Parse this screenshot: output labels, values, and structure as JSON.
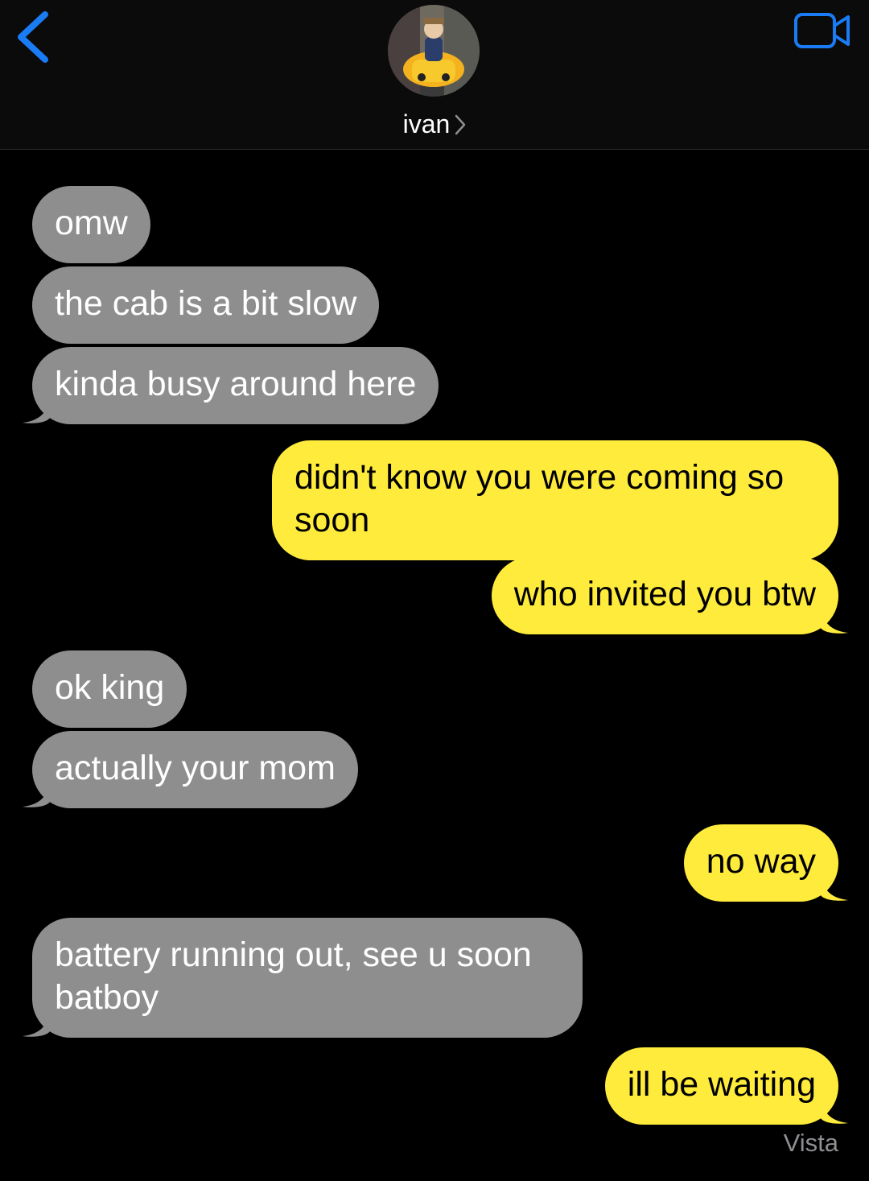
{
  "header": {
    "contact_name": "ivan",
    "back_icon": "chevron-left-icon",
    "video_icon": "video-camera-icon",
    "accent_color": "#1a7cf5"
  },
  "messages": [
    {
      "dir": "in",
      "text": "omw"
    },
    {
      "dir": "in",
      "text": "the cab is a bit slow"
    },
    {
      "dir": "in",
      "text": "kinda busy around here"
    },
    {
      "dir": "out",
      "text": "didn't know you were coming so soon"
    },
    {
      "dir": "out",
      "text": "who invited you btw"
    },
    {
      "dir": "in",
      "text": "ok king"
    },
    {
      "dir": "in",
      "text": "actually your mom"
    },
    {
      "dir": "out",
      "text": "no way"
    },
    {
      "dir": "in",
      "text": "battery running out, see u soon batboy"
    },
    {
      "dir": "out",
      "text": "ill be waiting"
    }
  ],
  "status": "Vista",
  "colors": {
    "incoming_bubble": "#8e8e8e",
    "outgoing_bubble": "#ffeb3b",
    "background": "#000000"
  }
}
